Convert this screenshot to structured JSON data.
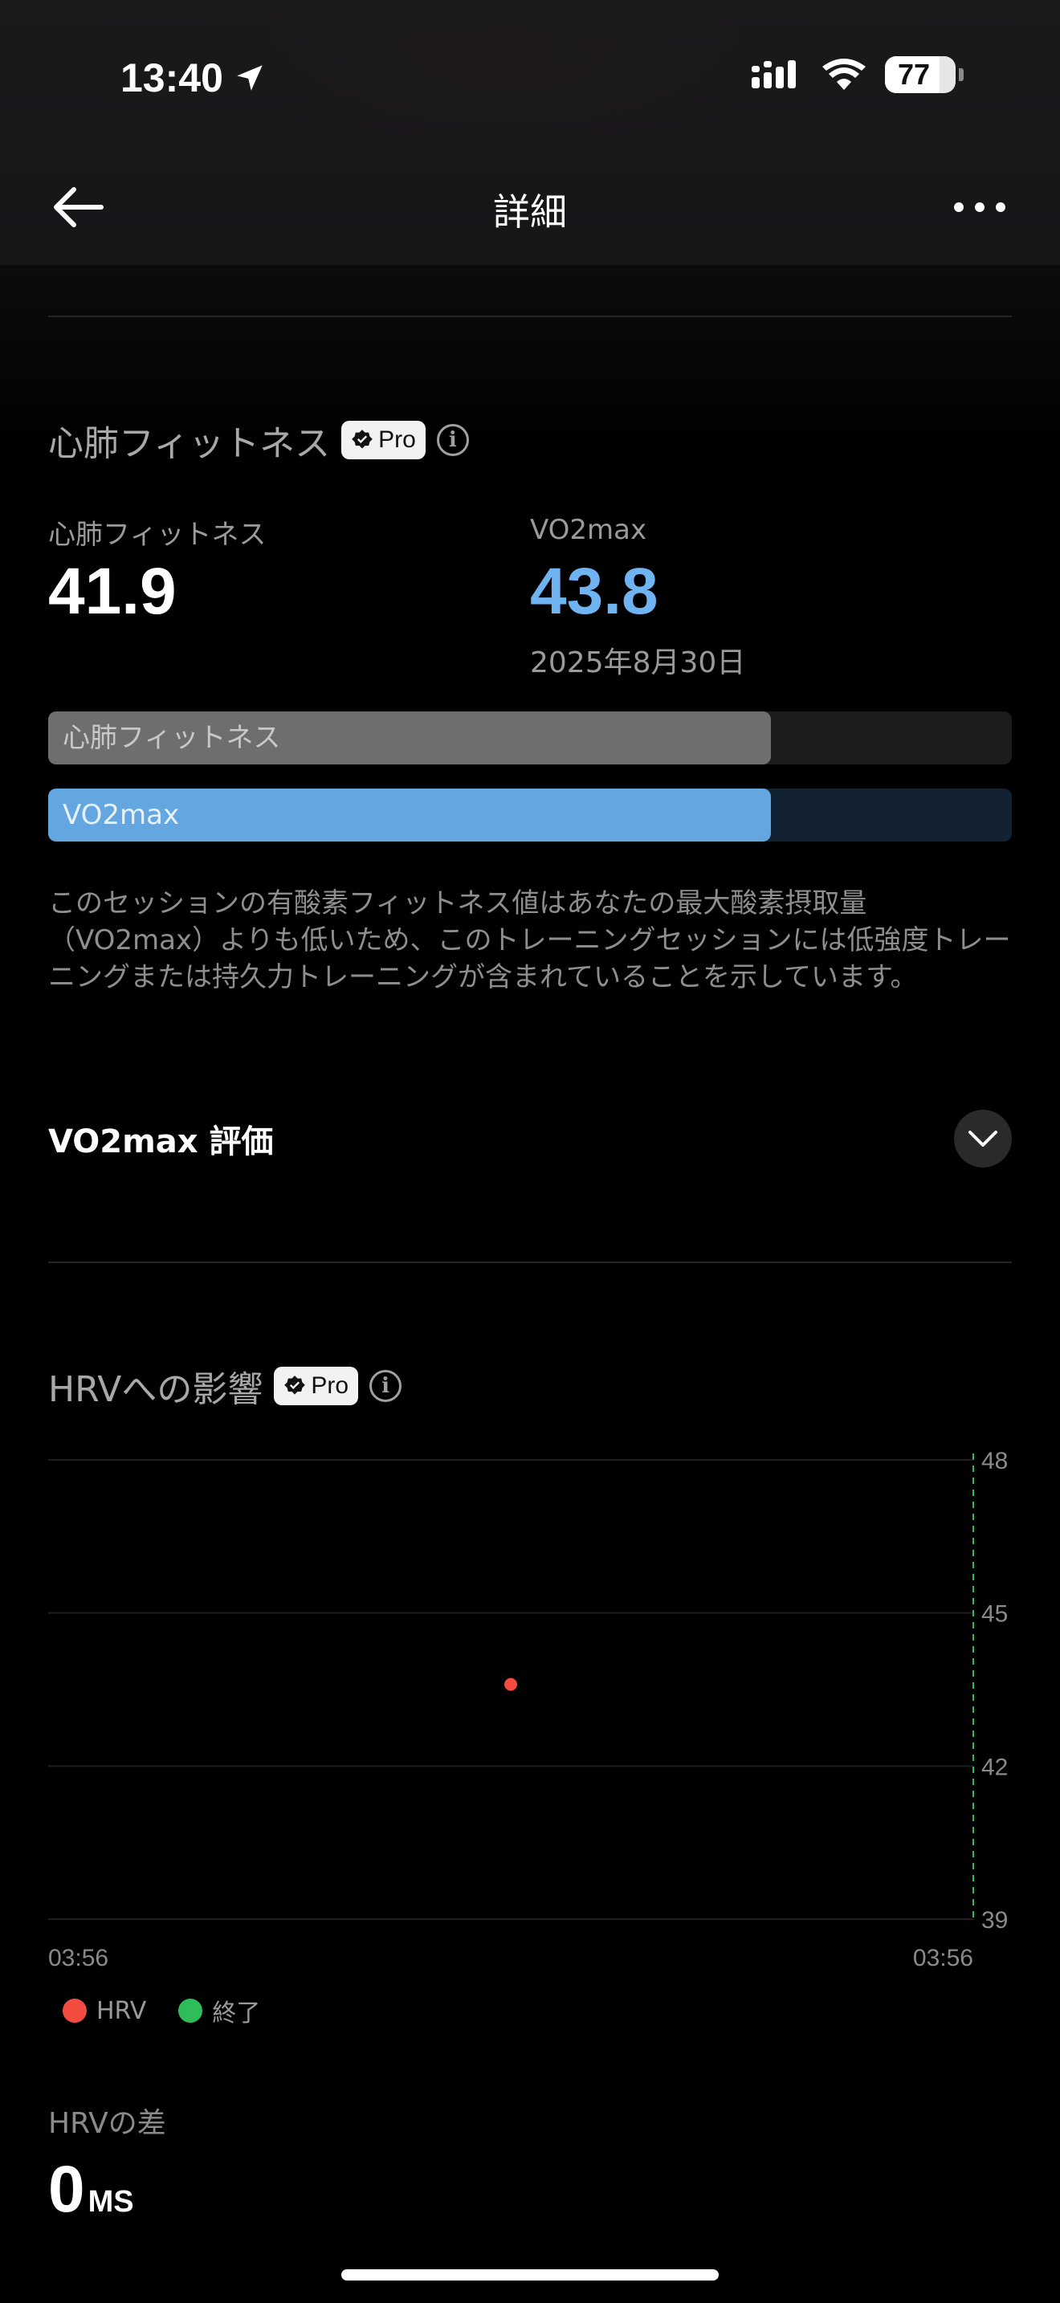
{
  "status_bar": {
    "time": "13:40",
    "battery": "77"
  },
  "nav": {
    "title": "詳細"
  },
  "cardio": {
    "title": "心肺フィットネス",
    "pro": "Pro",
    "info": "i",
    "left_label": "心肺フィットネス",
    "left_value": "41.9",
    "right_label": "VO2max",
    "right_value": "43.8",
    "right_date": "2025年8月30日",
    "bar1_label": "心肺フィットネス",
    "bar1_fraction": 0.75,
    "bar2_label": "VO2max",
    "bar2_fraction": 0.75,
    "description": "このセッションの有酸素フィットネス値はあなたの最大酸素摂取量（VO2max）よりも低いため、このトレーニングセッションには低強度トレーニングまたは持久力トレーニングが含まれていることを示しています。",
    "eval_label": "VO2max 評価"
  },
  "hrv": {
    "title": "HRVへの影響",
    "pro": "Pro",
    "info": "i",
    "legend_hrv": "HRV",
    "legend_end": "終了",
    "diff_label": "HRVの差",
    "diff_value": "0",
    "diff_unit": "MS"
  },
  "colors": {
    "accent_blue": "#63a6e0",
    "value_blue": "#6fb3f0",
    "hrv_red": "#f24b3f",
    "end_green": "#2ebd59",
    "gray_bar": "#6e6e6e"
  },
  "chart_data": {
    "type": "scatter",
    "x_labels": [
      "03:56",
      "03:56"
    ],
    "y_ticks": [
      "48",
      "45",
      "42",
      "39"
    ],
    "ylim": [
      39,
      48
    ],
    "series": [
      {
        "name": "HRV",
        "points": [
          {
            "x": 0.5,
            "y": 43.6
          }
        ]
      }
    ],
    "end_marker": {
      "name": "終了",
      "x": 1.0
    }
  }
}
